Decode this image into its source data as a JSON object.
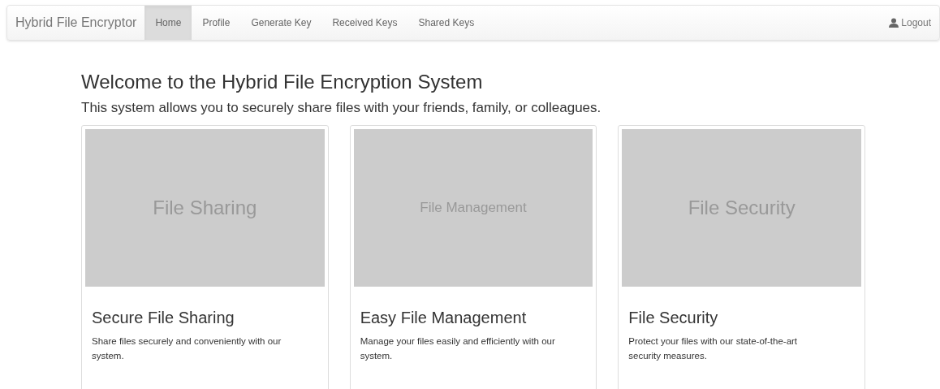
{
  "navbar": {
    "brand": "Hybrid File Encryptor",
    "items": [
      {
        "label": "Home",
        "selected": true
      },
      {
        "label": "Profile",
        "selected": false
      },
      {
        "label": "Generate Key",
        "selected": false
      },
      {
        "label": "Received Keys",
        "selected": false
      },
      {
        "label": "Shared Keys",
        "selected": false
      }
    ],
    "logout": "Logout"
  },
  "heading": "Welcome to the Hybrid File Encryption System",
  "lead": "This system allows you to securely share files with your friends, family, or colleagues.",
  "cards": [
    {
      "image_label": "File Sharing",
      "kind": "large",
      "title": "Secure File Sharing",
      "text": "Share files securely and conveniently with our system."
    },
    {
      "image_label": "File Management",
      "kind": "small",
      "title": "Easy File Management",
      "text": "Manage your files easily and efficiently with our system."
    },
    {
      "image_label": "File Security",
      "kind": "large",
      "title": "File Security",
      "text": "Protect your files with our state-of-the-art security measures."
    }
  ]
}
